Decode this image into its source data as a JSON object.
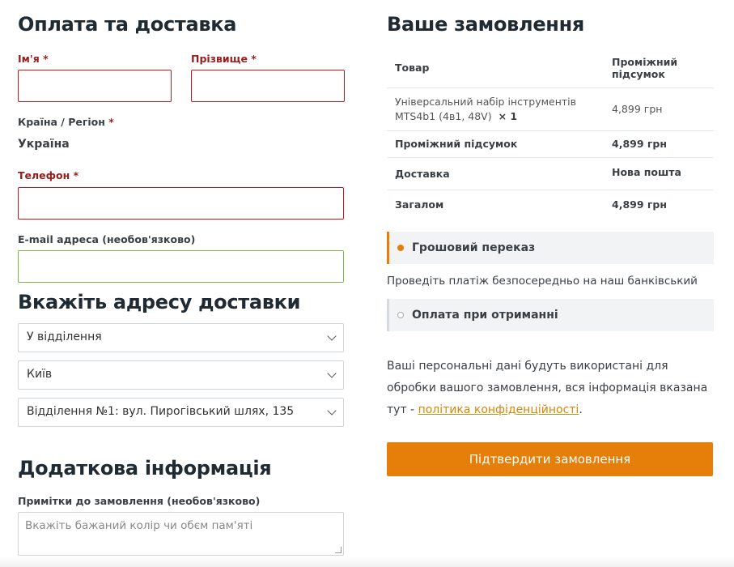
{
  "billing": {
    "title": "Оплата та доставка",
    "first_name_label": "Ім'я",
    "last_name_label": "Прізвище",
    "required_mark": "*",
    "country_label": "Країна / Регіон",
    "country_value": "Україна",
    "phone_label": "Телефон",
    "email_label": "E-mail адреса (необов'язково)",
    "first_name_value": "",
    "last_name_value": "",
    "phone_value": "",
    "email_value": ""
  },
  "shipping": {
    "title": "Вкажіть адресу доставки",
    "method_select": "У відділення",
    "city_select": "Київ",
    "branch_select": "Відділення №1: вул. Пирогівський шлях, 135"
  },
  "additional": {
    "title": "Додаткова інформація",
    "notes_label": "Примітки до замовлення (необов'язково)",
    "notes_placeholder": "Вкажіть бажаний колір чи обєм пам'яті"
  },
  "order": {
    "title": "Ваше замовлення",
    "col_product": "Товар",
    "col_subtotal_line1": "Проміжний",
    "col_subtotal_line2": "підсумок",
    "item_name_line1": "Універсальний набір інструментів",
    "item_name_line2": "MTS4b1 (4в1, 48V)",
    "item_qty": "× 1",
    "item_price": "4,899 грн",
    "subtotal_label": "Проміжний підсумок",
    "subtotal_value": "4,899 грн",
    "shipping_label": "Доставка",
    "shipping_value": "Нова пошта",
    "total_label": "Загалом",
    "total_value": "4,899 грн"
  },
  "payment": {
    "option1": "Грошовий переказ",
    "option1_description": "Проведіть платіж безпосередньо на наш банківський рахунок.",
    "option2": "Оплата при отриманні",
    "privacy_text": "Ваші персональні дані будуть використані для обробки вашого замовлення, вся інформація вказана тут -",
    "privacy_link": "політика конфіденційності",
    "privacy_end": ".",
    "submit_label": "Підтвердити замовлення"
  },
  "colors": {
    "accent": "#e67e0a",
    "error_border": "#b91c1c",
    "valid_border": "#7cb342"
  }
}
